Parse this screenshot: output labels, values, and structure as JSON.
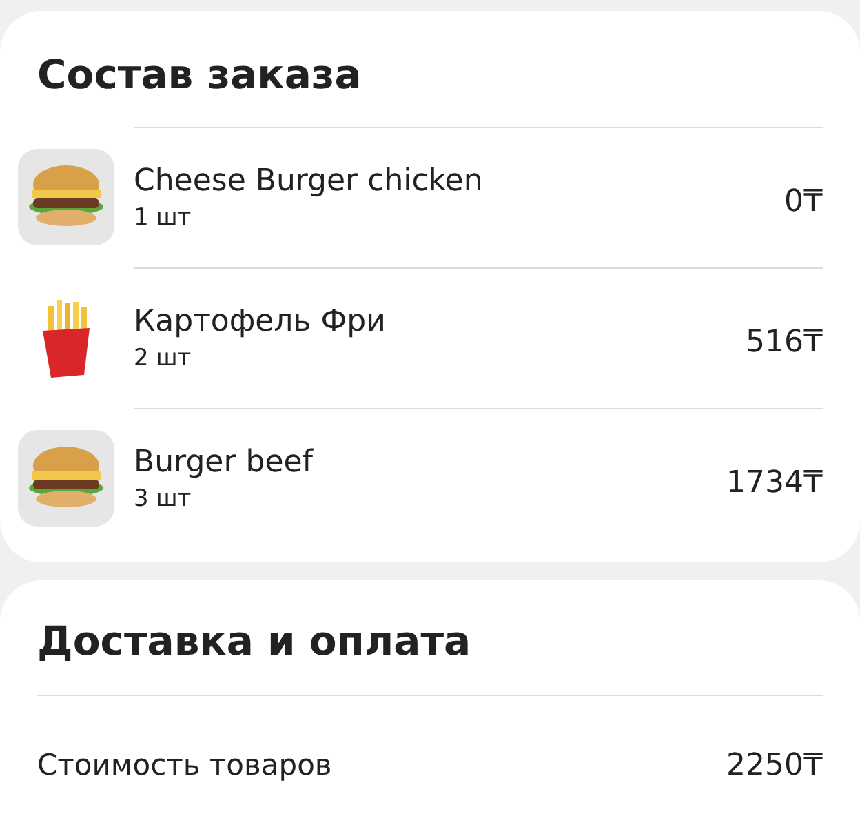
{
  "order_card": {
    "title": "Состав заказа",
    "items": [
      {
        "name": "Cheese Burger chicken",
        "quantity": "1 шт",
        "price": "0₸"
      },
      {
        "name": "Картофель Фри",
        "quantity": "2 шт",
        "price": "516₸"
      },
      {
        "name": "Burger beef",
        "quantity": "3 шт",
        "price": "1734₸"
      }
    ]
  },
  "delivery_card": {
    "title": "Доставка и оплата",
    "rows": [
      {
        "label": "Стоимость товаров",
        "value": "2250₸"
      }
    ]
  }
}
